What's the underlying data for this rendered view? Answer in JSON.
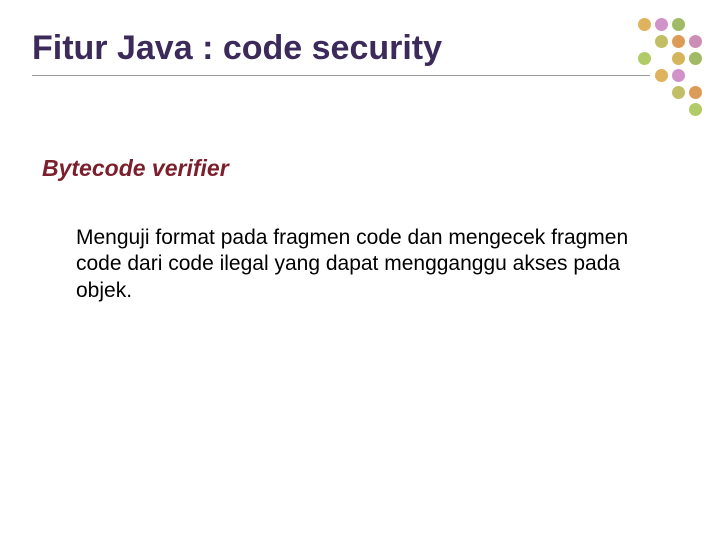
{
  "title": "Fitur Java : code security",
  "subtitle": "Bytecode verifier",
  "body": "Menguji format pada fragmen code dan mengecek fragmen code dari code ilegal yang dapat mengganggu akses pada objek.",
  "colors": {
    "title": "#3b2a5a",
    "subtitle": "#7a1f2b",
    "dotPalette": [
      "#d9a441",
      "#c97fbf",
      "#8fae4a",
      "#b7b34a",
      "#d68b3a",
      "#c47aa8",
      "#a3c24e",
      "#cda83e"
    ]
  },
  "dots": [
    {
      "r": 0,
      "c": 0,
      "color": "#d9a441"
    },
    {
      "r": 0,
      "c": 1,
      "color": "#c97fbf"
    },
    {
      "r": 0,
      "c": 2,
      "color": "#8fae4a"
    },
    {
      "r": 1,
      "c": 1,
      "color": "#b7b34a"
    },
    {
      "r": 1,
      "c": 2,
      "color": "#d68b3a"
    },
    {
      "r": 1,
      "c": 3,
      "color": "#c47aa8"
    },
    {
      "r": 2,
      "c": 0,
      "color": "#a3c24e"
    },
    {
      "r": 2,
      "c": 2,
      "color": "#cda83e"
    },
    {
      "r": 2,
      "c": 3,
      "color": "#8fae4a"
    },
    {
      "r": 3,
      "c": 1,
      "color": "#d9a441"
    },
    {
      "r": 3,
      "c": 2,
      "color": "#c97fbf"
    },
    {
      "r": 4,
      "c": 2,
      "color": "#b7b34a"
    },
    {
      "r": 4,
      "c": 3,
      "color": "#d68b3a"
    },
    {
      "r": 5,
      "c": 3,
      "color": "#a3c24e"
    }
  ]
}
